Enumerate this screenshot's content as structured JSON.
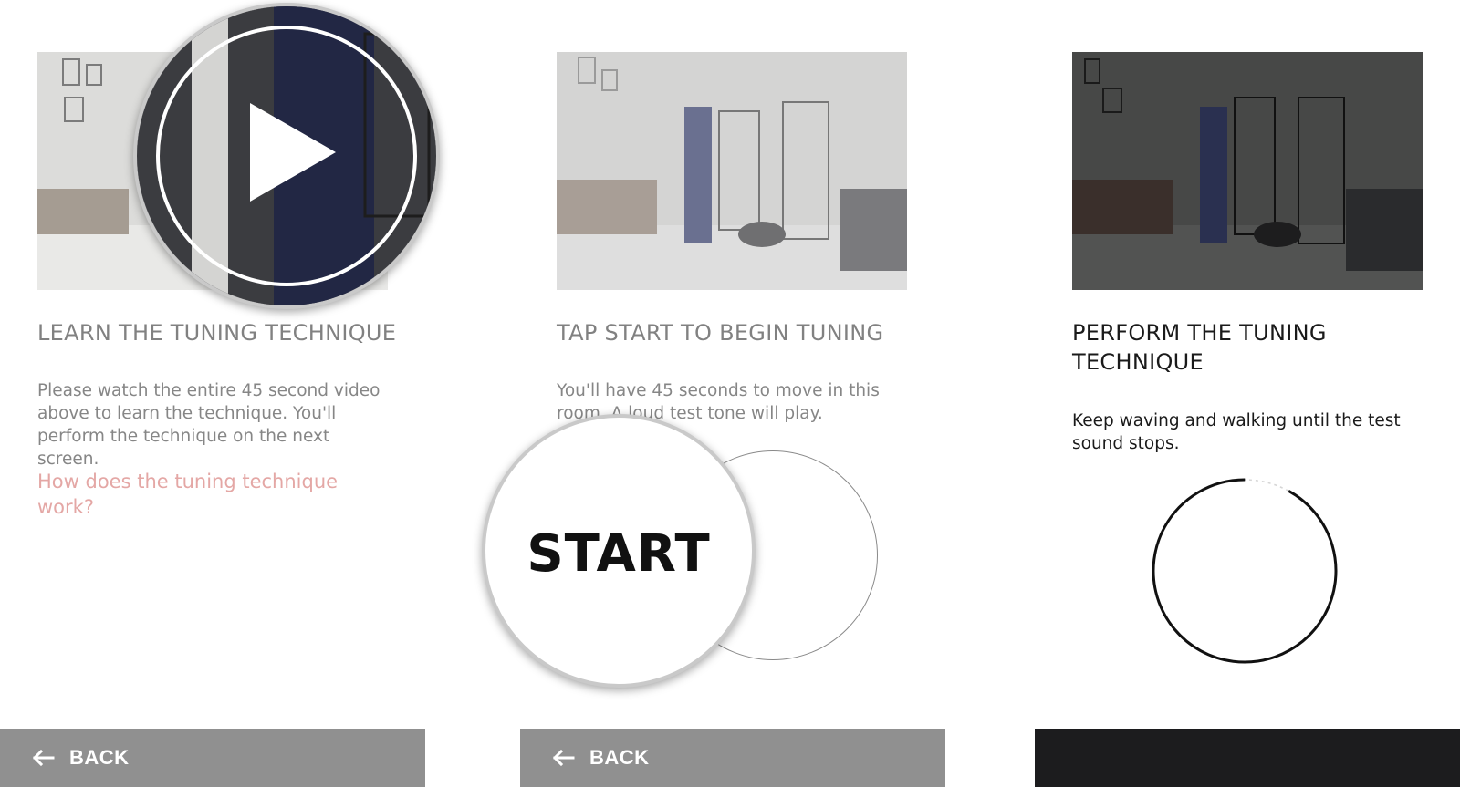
{
  "panels": [
    {
      "title": "LEARN THE TUNING TECHNIQUE",
      "description": "Please watch the entire 45 second video above to learn the technique. You'll perform the technique on the next screen.",
      "link": "How does the tuning technique work?",
      "back_label": "BACK",
      "video_icon": "play-icon"
    },
    {
      "title": "TAP START TO BEGIN TUNING",
      "description": "You'll have 45 seconds to move in this room. A loud test tone will play.",
      "start_label": "START",
      "back_label": "BACK"
    },
    {
      "title": "PERFORM THE TUNING TECHNIQUE",
      "description": "Keep waving and walking until the test sound stops.",
      "progress_fraction": 0.92
    }
  ],
  "colors": {
    "link": "#e4a7a5",
    "back_bar": "#909090",
    "dark_bar": "#1c1c1e",
    "muted_text": "#818181",
    "dark_text": "#1a1a1a"
  }
}
